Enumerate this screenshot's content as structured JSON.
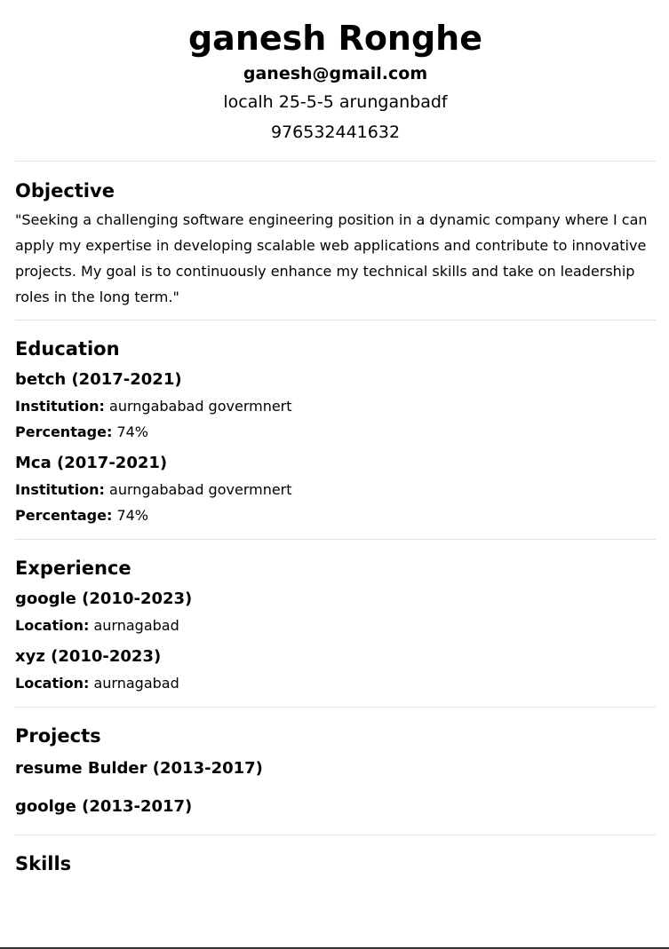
{
  "header": {
    "name": "ganesh Ronghe",
    "email": "ganesh@gmail.com",
    "address": "localh 25-5-5 arunganbadf",
    "phone": "976532441632"
  },
  "objective": {
    "title": "Objective",
    "text": "\"Seeking a challenging software engineering position in a dynamic company where I can apply my expertise in developing scalable web applications and contribute to innovative projects. My goal is to continuously enhance my technical skills and take on leadership roles in the long term.\""
  },
  "labels": {
    "institution": "Institution:",
    "percentage": "Percentage:",
    "location": "Location:"
  },
  "education": {
    "title": "Education",
    "items": [
      {
        "title": "betch (2017-2021)",
        "institution": "aurngababad govermnert",
        "percentage": "74%"
      },
      {
        "title": "Mca (2017-2021)",
        "institution": "aurngababad govermnert",
        "percentage": "74%"
      }
    ]
  },
  "experience": {
    "title": "Experience",
    "items": [
      {
        "title": "google (2010-2023)",
        "location": "aurnagabad"
      },
      {
        "title": "xyz (2010-2023)",
        "location": "aurnagabad"
      }
    ]
  },
  "projects": {
    "title": "Projects",
    "items": [
      {
        "title": "resume Bulder (2013-2017)"
      },
      {
        "title": "goolge (2013-2017)"
      }
    ]
  },
  "skills": {
    "title": "Skills"
  }
}
